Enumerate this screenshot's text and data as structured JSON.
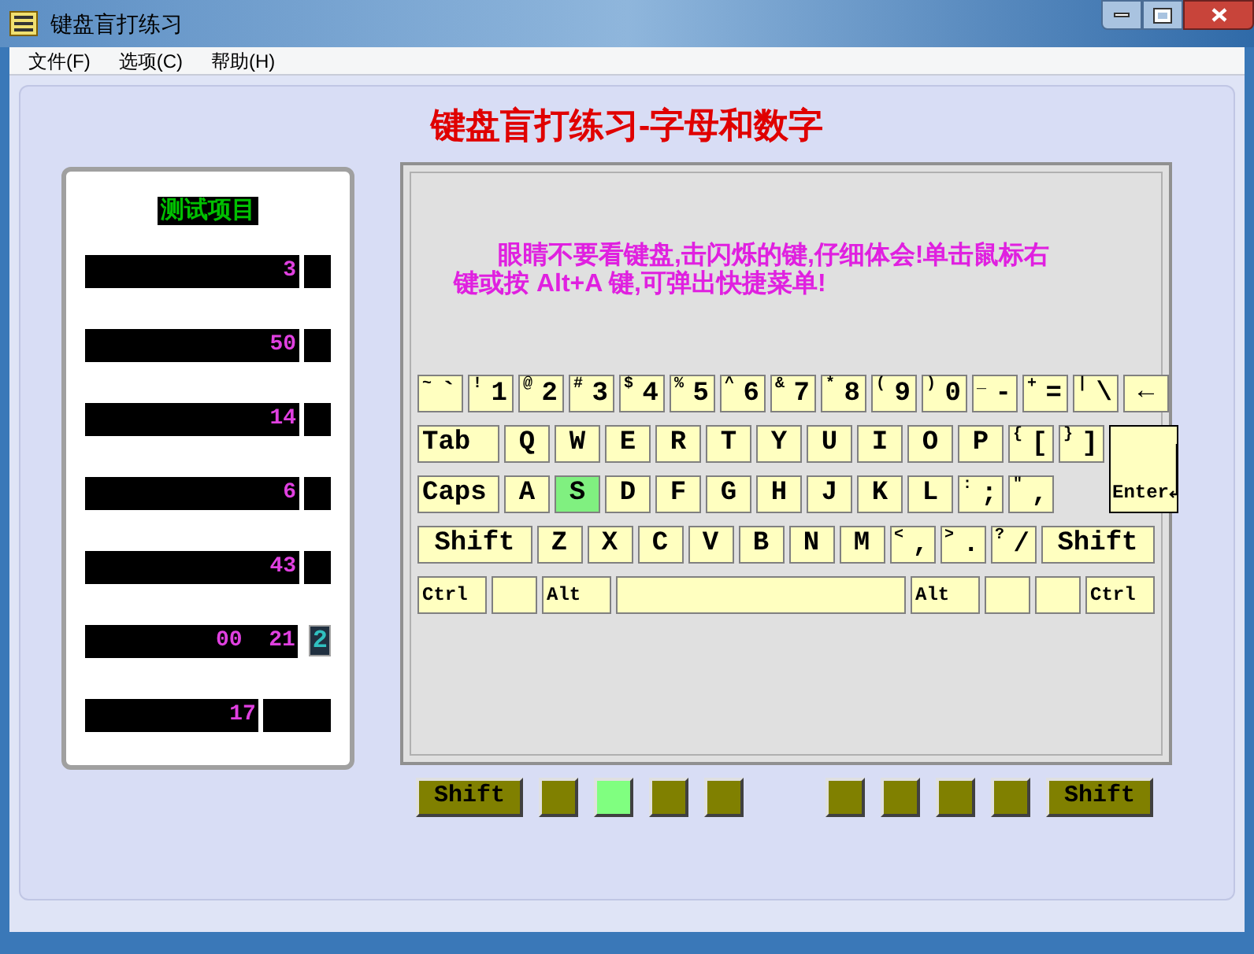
{
  "window": {
    "title": "键盘盲打练习"
  },
  "menu": [
    "文件(F)",
    "选项(C)",
    "帮助(H)"
  ],
  "heading": "键盘盲打练习-字母和数字",
  "stats_panel": {
    "title": "测试项目",
    "rows": [
      {
        "value": "3",
        "kind": "plain"
      },
      {
        "value": "50",
        "kind": "plain"
      },
      {
        "value": "14",
        "kind": "plain"
      },
      {
        "value": "6",
        "kind": "plain"
      },
      {
        "value": "43",
        "kind": "plain"
      },
      {
        "value": "00  21",
        "kind": "badge",
        "badge": "2"
      },
      {
        "value": "17",
        "kind": "wide"
      }
    ]
  },
  "instruction": "眼睛不要看键盘,击闪烁的键,仔细体会!单击鼠标右键或按 Alt+A 键,可弹出快捷菜单!",
  "keyboard": {
    "rows": [
      {
        "keys": [
          {
            "kind": "dual",
            "upper": "~",
            "lower": "`",
            "selected": false
          },
          {
            "kind": "dual",
            "upper": "!",
            "lower": "1",
            "selected": false
          },
          {
            "kind": "dual",
            "upper": "@",
            "lower": "2",
            "selected": false
          },
          {
            "kind": "dual",
            "upper": "#",
            "lower": "3",
            "selected": false
          },
          {
            "kind": "dual",
            "upper": "$",
            "lower": "4",
            "selected": false
          },
          {
            "kind": "dual",
            "upper": "%",
            "lower": "5",
            "selected": false
          },
          {
            "kind": "dual",
            "upper": "^",
            "lower": "6",
            "selected": false
          },
          {
            "kind": "dual",
            "upper": "&",
            "lower": "7",
            "selected": false
          },
          {
            "kind": "dual",
            "upper": "*",
            "lower": "8",
            "selected": false
          },
          {
            "kind": "dual",
            "upper": "(",
            "lower": "9",
            "selected": false
          },
          {
            "kind": "dual",
            "upper": ")",
            "lower": "0",
            "selected": false
          },
          {
            "kind": "dual",
            "upper": "_",
            "lower": "-",
            "selected": false
          },
          {
            "kind": "dual",
            "upper": "+",
            "lower": "=",
            "selected": false
          },
          {
            "kind": "dual",
            "upper": "|",
            "lower": "\\",
            "selected": false
          },
          {
            "kind": "char",
            "label": "←",
            "selected": false
          }
        ]
      },
      {
        "keys": [
          {
            "kind": "mod",
            "label": "Tab",
            "selected": false
          },
          {
            "kind": "char",
            "label": "Q",
            "selected": false
          },
          {
            "kind": "char",
            "label": "W",
            "selected": false
          },
          {
            "kind": "char",
            "label": "E",
            "selected": false
          },
          {
            "kind": "char",
            "label": "R",
            "selected": false
          },
          {
            "kind": "char",
            "label": "T",
            "selected": false
          },
          {
            "kind": "char",
            "label": "Y",
            "selected": false
          },
          {
            "kind": "char",
            "label": "U",
            "selected": false
          },
          {
            "kind": "char",
            "label": "I",
            "selected": false
          },
          {
            "kind": "char",
            "label": "O",
            "selected": false
          },
          {
            "kind": "char",
            "label": "P",
            "selected": false
          },
          {
            "kind": "dual",
            "upper": "{",
            "lower": "[",
            "selected": false
          },
          {
            "kind": "dual",
            "upper": "}",
            "lower": "]",
            "selected": false
          }
        ]
      },
      {
        "keys": [
          {
            "kind": "mod",
            "label": "Caps",
            "selected": false
          },
          {
            "kind": "char",
            "label": "A",
            "selected": false
          },
          {
            "kind": "char",
            "label": "S",
            "selected": true
          },
          {
            "kind": "char",
            "label": "D",
            "selected": false
          },
          {
            "kind": "char",
            "label": "F",
            "selected": false
          },
          {
            "kind": "char",
            "label": "G",
            "selected": false
          },
          {
            "kind": "char",
            "label": "H",
            "selected": false
          },
          {
            "kind": "char",
            "label": "J",
            "selected": false
          },
          {
            "kind": "char",
            "label": "K",
            "selected": false
          },
          {
            "kind": "char",
            "label": "L",
            "selected": false
          },
          {
            "kind": "dual",
            "upper": ":",
            "lower": ";",
            "selected": false
          },
          {
            "kind": "dual",
            "upper": "\"",
            "lower": ",",
            "selected": false
          },
          {
            "kind": "enter",
            "label": "Enter",
            "selected": false
          }
        ]
      },
      {
        "keys": [
          {
            "kind": "shift",
            "label": "Shift",
            "selected": false
          },
          {
            "kind": "char",
            "label": "Z",
            "selected": false
          },
          {
            "kind": "char",
            "label": "X",
            "selected": false
          },
          {
            "kind": "char",
            "label": "C",
            "selected": false
          },
          {
            "kind": "char",
            "label": "V",
            "selected": false
          },
          {
            "kind": "char",
            "label": "B",
            "selected": false
          },
          {
            "kind": "char",
            "label": "N",
            "selected": false
          },
          {
            "kind": "char",
            "label": "M",
            "selected": false
          },
          {
            "kind": "dual",
            "upper": "<",
            "lower": ",",
            "selected": false
          },
          {
            "kind": "dual",
            "upper": ">",
            "lower": ".",
            "selected": false
          },
          {
            "kind": "dual",
            "upper": "?",
            "lower": "/",
            "selected": false
          },
          {
            "kind": "shift",
            "label": "Shift",
            "selected": false
          }
        ]
      },
      {
        "keys": [
          {
            "kind": "small",
            "label": "Ctrl",
            "selected": false
          },
          {
            "kind": "blank",
            "selected": false
          },
          {
            "kind": "small",
            "label": "Alt",
            "selected": false
          },
          {
            "kind": "space",
            "selected": false
          },
          {
            "kind": "small",
            "label": "Alt",
            "selected": false
          },
          {
            "kind": "blank",
            "selected": false
          },
          {
            "kind": "blank",
            "selected": false
          },
          {
            "kind": "small",
            "label": "Ctrl",
            "selected": false
          }
        ]
      }
    ]
  },
  "fingers": [
    {
      "kind": "shift",
      "label": "Shift",
      "selected": false
    },
    {
      "kind": "finger",
      "selected": false
    },
    {
      "kind": "finger",
      "selected": true
    },
    {
      "kind": "finger",
      "selected": false
    },
    {
      "kind": "finger",
      "selected": false
    },
    {
      "kind": "gap"
    },
    {
      "kind": "finger",
      "selected": false
    },
    {
      "kind": "finger",
      "selected": false
    },
    {
      "kind": "finger",
      "selected": false
    },
    {
      "kind": "finger",
      "selected": false
    },
    {
      "kind": "shift",
      "label": "Shift",
      "selected": false
    }
  ]
}
